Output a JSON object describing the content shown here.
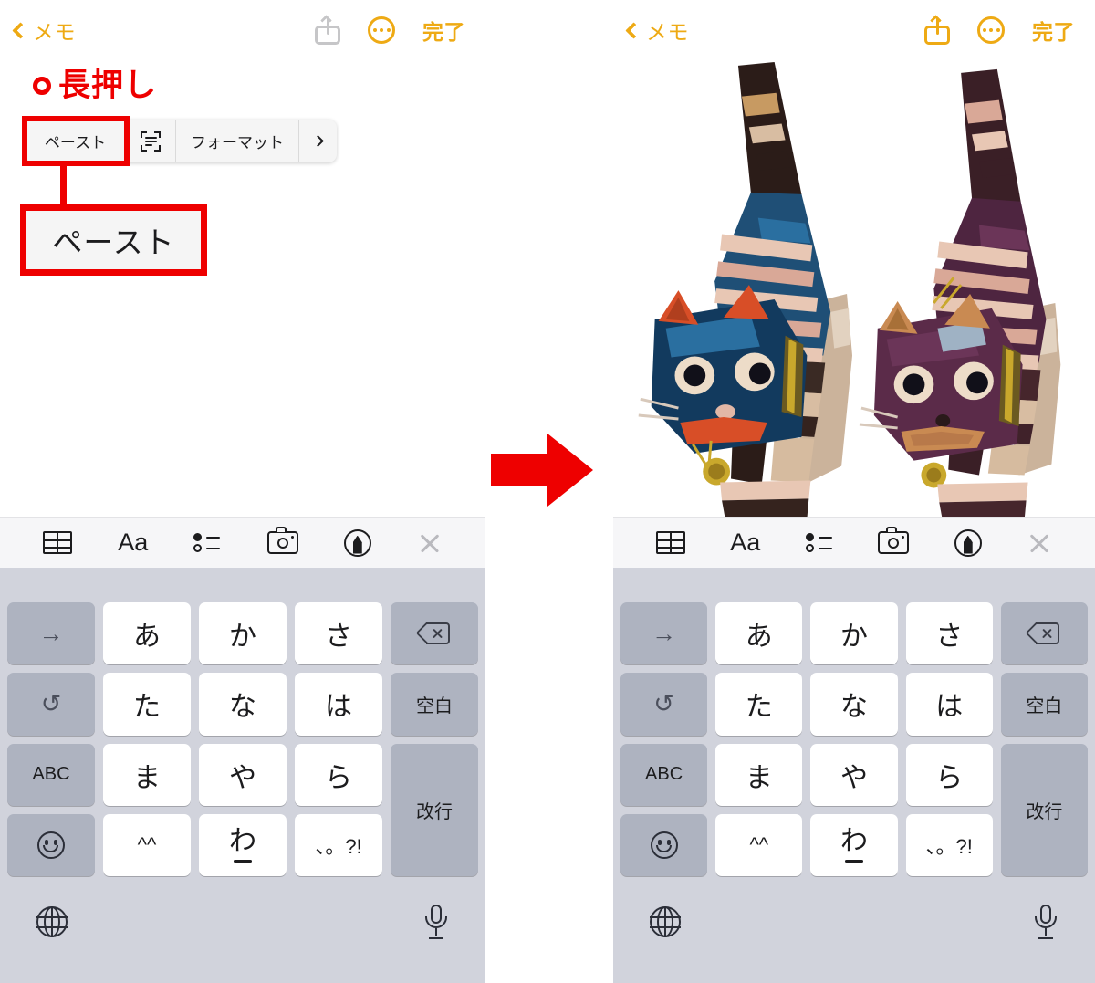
{
  "nav": {
    "back_label": "メモ",
    "done_label": "完了",
    "back_icon": "chevron-left-icon",
    "share_icon": "share-icon",
    "more_icon": "more-ellipsis-icon"
  },
  "edit_menu": {
    "paste_label": "ペースト",
    "scan_icon": "scan-text-icon",
    "format_label": "フォーマット",
    "next_icon": "chevron-right-icon"
  },
  "annotations": {
    "longpress_label": "長押し",
    "longpress_marker_icon": "circle-marker-icon",
    "callout_label": "ペースト",
    "arrow_icon": "right-arrow-icon",
    "accent_red": "#ee0000"
  },
  "photo": {
    "alt": "二匹の木彫りの猫の置物（青と紫、ピンクの縞模様）"
  },
  "accessory_bar": {
    "items": [
      {
        "name": "table-icon",
        "label": ""
      },
      {
        "name": "text-format-icon",
        "label": "Aa"
      },
      {
        "name": "checklist-icon",
        "label": ""
      },
      {
        "name": "camera-icon",
        "label": ""
      },
      {
        "name": "markup-pen-icon",
        "label": ""
      },
      {
        "name": "close-icon",
        "label": ""
      }
    ]
  },
  "keyboard": {
    "rows": [
      [
        {
          "label": "→",
          "type": "fn",
          "icon": "arrow-right-icon"
        },
        {
          "label": "あ",
          "type": "white"
        },
        {
          "label": "か",
          "type": "white"
        },
        {
          "label": "さ",
          "type": "white"
        },
        {
          "label": "",
          "type": "fn",
          "icon": "delete-backward-icon"
        }
      ],
      [
        {
          "label": "↺",
          "type": "fn",
          "icon": "undo-icon"
        },
        {
          "label": "た",
          "type": "white"
        },
        {
          "label": "な",
          "type": "white"
        },
        {
          "label": "は",
          "type": "white"
        },
        {
          "label": "空白",
          "type": "fn"
        }
      ],
      [
        {
          "label": "ABC",
          "type": "fn"
        },
        {
          "label": "ま",
          "type": "white"
        },
        {
          "label": "や",
          "type": "white"
        },
        {
          "label": "ら",
          "type": "white"
        },
        {
          "label": "改行",
          "type": "fn"
        }
      ],
      [
        {
          "label": "",
          "type": "fn",
          "icon": "emoji-icon"
        },
        {
          "label": "^^",
          "type": "white"
        },
        {
          "label": "わ",
          "type": "white"
        },
        {
          "label": "、。?!",
          "type": "white"
        }
      ]
    ],
    "bottom": {
      "globe_icon": "globe-icon",
      "mic_icon": "microphone-icon"
    },
    "colors": {
      "background": "#d1d3dc",
      "function_key": "#aeb3c0",
      "letter_key": "#ffffff"
    }
  },
  "colors": {
    "accent_orange": "#eeaa14",
    "disabled_gray": "#c6c6c8",
    "toolbar_bg": "#f6f6f8"
  }
}
